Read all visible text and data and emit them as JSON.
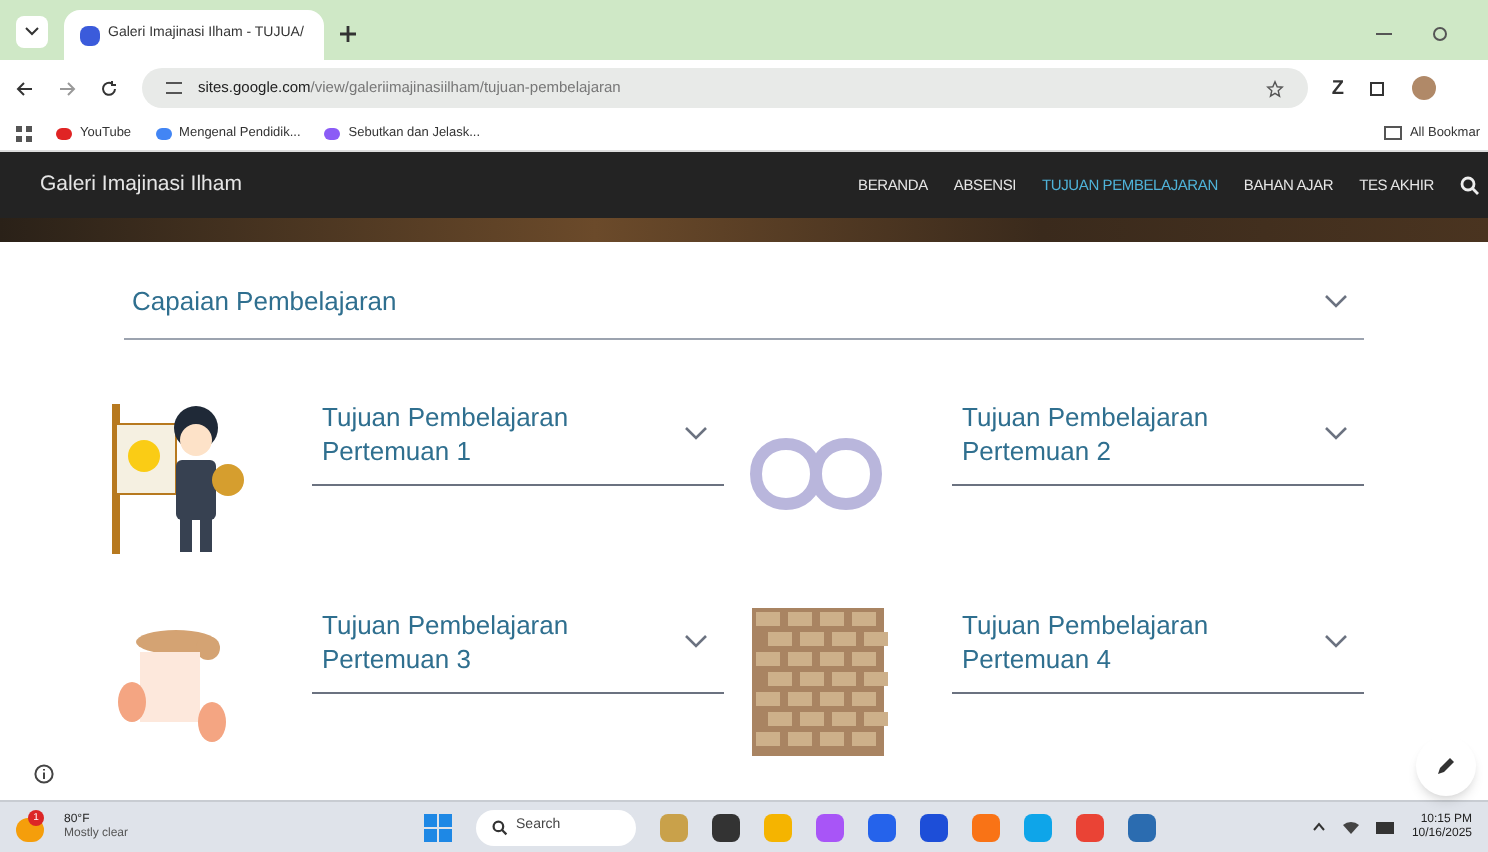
{
  "browser": {
    "tab_title": "Galeri Imajinasi Ilham - TUJUA/",
    "url_host": "sites.google.com",
    "url_path": "/view/galeriimajinasiilham/tujuan-pembelajaran",
    "bookmarks": [
      "YouTube",
      "Mengenal Pendidik...",
      "Sebutkan dan Jelask..."
    ],
    "all_bookmarks": "All Bookmar",
    "profile_letter": "Z"
  },
  "site": {
    "title": "Galeri Imajinasi Ilham",
    "nav": [
      {
        "label": "BERANDA",
        "selected": false
      },
      {
        "label": "ABSENSI",
        "selected": false
      },
      {
        "label": "TUJUAN PEMBELAJARAN",
        "selected": true
      },
      {
        "label": "BAHAN AJAR",
        "selected": false
      },
      {
        "label": "TES AKHIR",
        "selected": false
      }
    ]
  },
  "section": {
    "title": "Capaian Pembelajaran",
    "expanded": false
  },
  "items": [
    {
      "title": "Tujuan Pembelajaran Pertemuan 1",
      "expanded": false,
      "kind": "picture"
    },
    {
      "title": "Tujuan Pembelajaran Pertemuan 2",
      "expanded": false,
      "kind": "picture"
    },
    {
      "title": "Tujuan Pembelajaran Pertemuan 3",
      "expanded": false,
      "kind": "picture"
    },
    {
      "title": "Tujuan Pembelajaran Pertemuan 4",
      "expanded": false,
      "kind": "picture"
    }
  ],
  "taskbar": {
    "weather_temp": "80°F",
    "weather_text": "Mostly clear",
    "weather_badge": "1",
    "search": "Search",
    "time": "10:15 PM",
    "date": "10/16/2025"
  }
}
